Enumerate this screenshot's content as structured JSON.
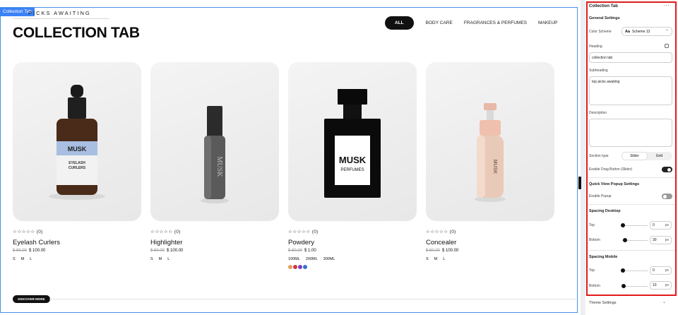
{
  "preview": {
    "section_tag": "Collection Tab",
    "subheading": "PICKS AWAITING",
    "heading": "COLLECTION TAB",
    "tabs": [
      {
        "label": "ALL",
        "active": true
      },
      {
        "label": "BODY CARE",
        "active": false
      },
      {
        "label": "FRAGRANCES & PERFUMES",
        "active": false
      },
      {
        "label": "MAKEUP",
        "active": false
      }
    ],
    "products": [
      {
        "stars": "☆☆☆☆☆",
        "reviews": "(0)",
        "name": "Eyelash Curlers",
        "old_price": "$ 60.00",
        "price": "$ 100.00",
        "options": [
          "S",
          "M",
          "L"
        ],
        "bottle_brand": "MUSK",
        "bottle_text": "EYELASH CURLERS"
      },
      {
        "stars": "☆☆☆☆☆",
        "reviews": "(0)",
        "name": "Highlighter",
        "old_price": "$ 60.00",
        "price": "$ 100.00",
        "options": [
          "S",
          "M",
          "L"
        ],
        "bottle_brand": "MUSK"
      },
      {
        "stars": "☆☆☆☆☆",
        "reviews": "(0)",
        "name": "Powdery",
        "old_price": "$ 60.00",
        "price": "$ 1.00",
        "options": [
          "100ML",
          "200ML",
          "300ML"
        ],
        "swatch_colors": [
          "#e0a060",
          "#d23a3a",
          "#7a3fc0",
          "#3a6fd0"
        ],
        "bottle_brand": "MUSK",
        "bottle_text": "PERFUMES"
      },
      {
        "stars": "☆☆☆☆☆",
        "reviews": "(0)",
        "name": "Concealer",
        "old_price": "$ 60.00",
        "price": "$ 100.00",
        "options": [
          "S",
          "M",
          "L"
        ],
        "bottle_brand": "MUSK"
      }
    ],
    "discover_label": "DISCOVER MORE"
  },
  "panel": {
    "title": "Collection Tab",
    "more_icon": "more-horizontal-icon",
    "general_settings": "General Settings",
    "color_scheme_label": "Color Scheme",
    "color_scheme_value": "Scheme 13",
    "heading_label": "Heading",
    "heading_value": "collection tab",
    "subheading_label": "Subheading",
    "subheading_value": "top picks awaiting",
    "description_label": "Description",
    "description_value": "",
    "section_type_label": "Section type",
    "section_type_options": [
      "Slider",
      "Grid"
    ],
    "section_type_selected": "Slider",
    "drag_button_label": "Enable Drag Button (Slider)",
    "drag_button_on": true,
    "quick_view_title": "Quick View Popup Settings",
    "enable_popup_label": "Enable Popup",
    "enable_popup_on": false,
    "spacing_desktop_title": "Spacing Desktop",
    "spacing_desktop": {
      "top_label": "Top",
      "top_value": "0",
      "bottom_label": "Bottom",
      "bottom_value": "30",
      "unit": "px"
    },
    "spacing_mobile_title": "Spacing Mobile",
    "spacing_mobile": {
      "top_label": "Top",
      "top_value": "0",
      "bottom_label": "Bottom",
      "bottom_value": "10",
      "unit": "px"
    },
    "theme_settings": "Theme Settings"
  },
  "colors": {
    "selection": "#4a8fe7",
    "panel_highlight": "#e01b1b",
    "accent": "#111111"
  }
}
